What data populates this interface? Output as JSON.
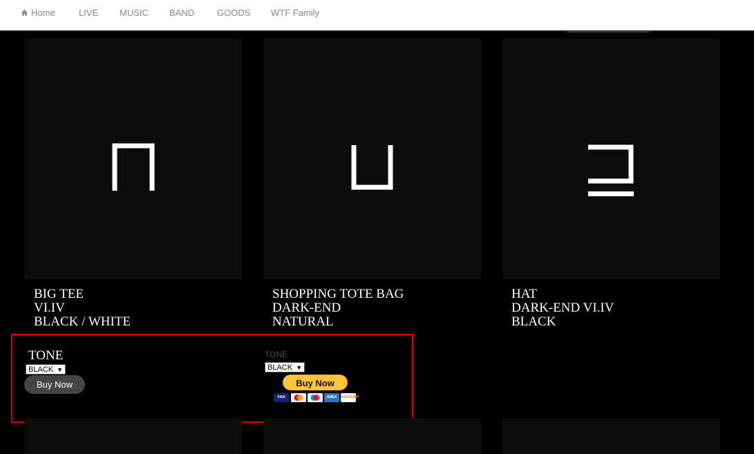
{
  "nav": {
    "items": [
      {
        "label": "Home",
        "icon": "home-icon"
      },
      {
        "label": "LIVE"
      },
      {
        "label": "MUSIC"
      },
      {
        "label": "BAND"
      },
      {
        "label": "GOODS"
      },
      {
        "label": "WTF Family"
      }
    ]
  },
  "products": [
    {
      "lines": [
        "BIG TEE",
        "VI.IV",
        "BLACK / WHITE"
      ],
      "glyph": "box-open-bottom-icon"
    },
    {
      "lines": [
        "SHOPPING TOTE BAG",
        "DARK-END",
        "NATURAL"
      ],
      "glyph": "box-open-top-icon"
    },
    {
      "lines": [
        "HAT",
        "DARK-END VI.IV",
        "BLACK"
      ],
      "glyph": "box-open-left-icon"
    }
  ],
  "purchase1": {
    "tone_label": "TONE",
    "selected": "BLACK",
    "button_label": "Buy Now"
  },
  "purchase2": {
    "tone_label": "TONE",
    "selected": "BLACK",
    "button_label": "Buy Now",
    "card_logos": [
      "VISA",
      "MC",
      "MAESTRO",
      "AMEX",
      "DISCOVER"
    ]
  },
  "colors": {
    "highlight": "#e00000",
    "paypal": "#ffc439",
    "background": "#000000"
  }
}
